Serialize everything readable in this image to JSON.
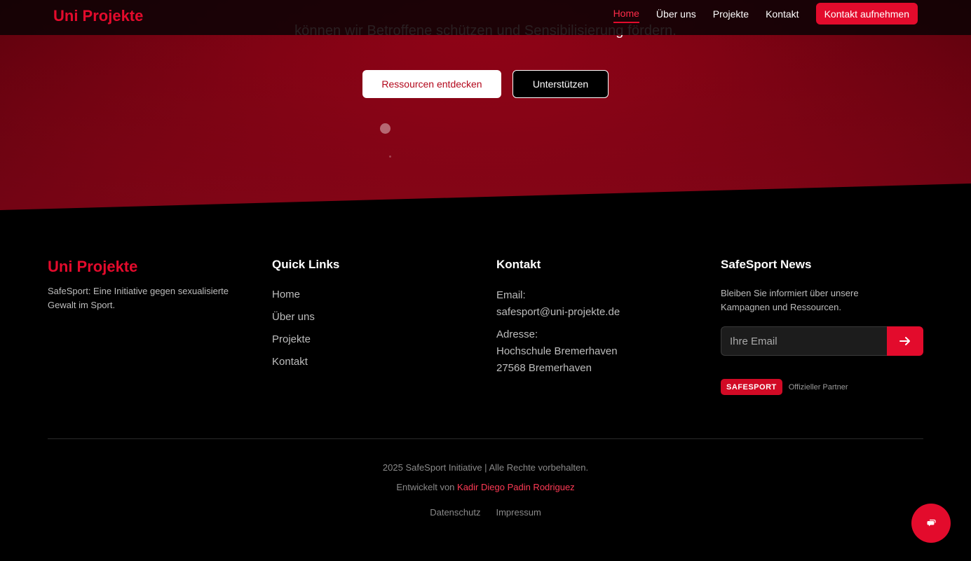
{
  "nav": {
    "logo": "Uni Projekte",
    "links": [
      "Home",
      "Über uns",
      "Projekte",
      "Kontakt"
    ],
    "active": "Home",
    "cta": "Kontakt aufnehmen"
  },
  "hero": {
    "text": "können wir Betroffene schützen und Sensibilisierung fördern.",
    "primary_button": "Ressourcen entdecken",
    "secondary_button": "Unterstützen"
  },
  "footer": {
    "brand": {
      "title": "Uni Projekte",
      "description": "SafeSport: Eine Initiative gegen sexualisierte Gewalt im Sport."
    },
    "quick_links": {
      "title": "Quick Links",
      "items": [
        "Home",
        "Über uns",
        "Projekte",
        "Kontakt"
      ]
    },
    "contact": {
      "title": "Kontakt",
      "email_label": "Email:",
      "email": "safesport@uni-projekte.de",
      "address_label": "Adresse:",
      "address_line1": "Hochschule Bremerhaven",
      "address_line2": "27568 Bremerhaven"
    },
    "news": {
      "title": "SafeSport News",
      "description": "Bleiben Sie informiert über unsere Kampagnen und Ressourcen.",
      "email_placeholder": "Ihre Email",
      "badge": "SAFESPORT",
      "partner_text": "Offizieller Partner"
    },
    "copyright": "2025 SafeSport Initiative | Alle Rechte vorbehalten.",
    "developed_by_label": "Entwickelt von",
    "developer": "Kadir Diego Padin Rodriguez",
    "legal": [
      "Datenschutz",
      "Impressum"
    ]
  },
  "icons": {
    "subscribe": "arrow-right-icon",
    "chat": "chat-bubble-icon"
  },
  "colors": {
    "accent": "#e30b2c",
    "hero_red": "#8e0216",
    "background": "#000000"
  }
}
